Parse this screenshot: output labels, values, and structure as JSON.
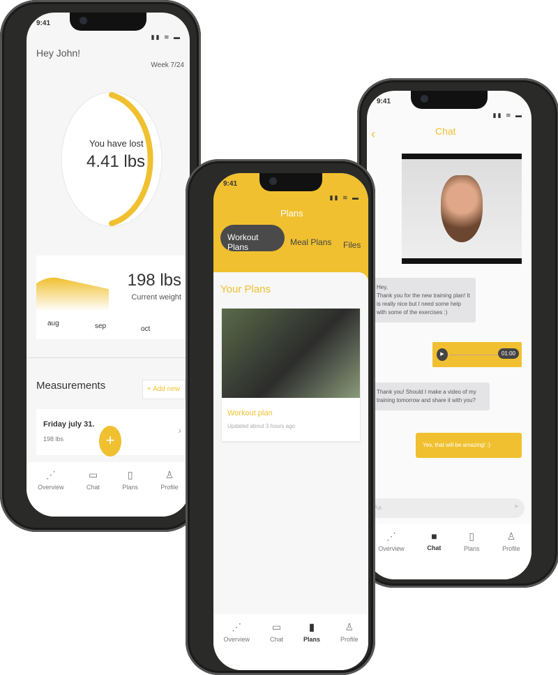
{
  "colors": {
    "accent": "#f0c030",
    "dark": "#4a4a4a"
  },
  "status": {
    "time": "9:41"
  },
  "overview": {
    "greeting": "Hey John!",
    "week": "Week 7/24",
    "lost_label": "You have lost",
    "lost_value": "4.41 lbs",
    "progress_percent": 0.45,
    "weight_value": "198 lbs",
    "weight_label": "Current weight",
    "months": [
      "aug",
      "sep",
      "oct"
    ],
    "measurements_title": "Measurements",
    "add_new": "+ Add new",
    "entry_date": "Friday july 31.",
    "entry_weight": "198 lbs",
    "fab_icon": "plus-icon"
  },
  "tabs": [
    {
      "label": "Overview",
      "icon": "graph-icon"
    },
    {
      "label": "Chat",
      "icon": "chat-icon"
    },
    {
      "label": "Plans",
      "icon": "document-icon"
    },
    {
      "label": "Profile",
      "icon": "profile-icon"
    }
  ],
  "plans": {
    "title": "Plans",
    "tabs": [
      "Workout Plans",
      "Meal Plans",
      "Files"
    ],
    "section": "Your Plans",
    "card_title": "Workout plan",
    "card_sub": "Updated about 3 hours ago"
  },
  "chat": {
    "title": "Chat",
    "messages": [
      {
        "from": "them",
        "text": "Hey,\nThank you for the new training plan! It is really nice but I need some help with some of the exercises :)"
      },
      {
        "from": "me",
        "audio_duration": "01:00"
      },
      {
        "from": "them",
        "text": "Thank you! Should I make a video of my training tomorrow and share it with you?"
      },
      {
        "from": "me",
        "text": "Yes, that will be amazing! :)"
      }
    ],
    "input_placeholder": "Aa"
  }
}
